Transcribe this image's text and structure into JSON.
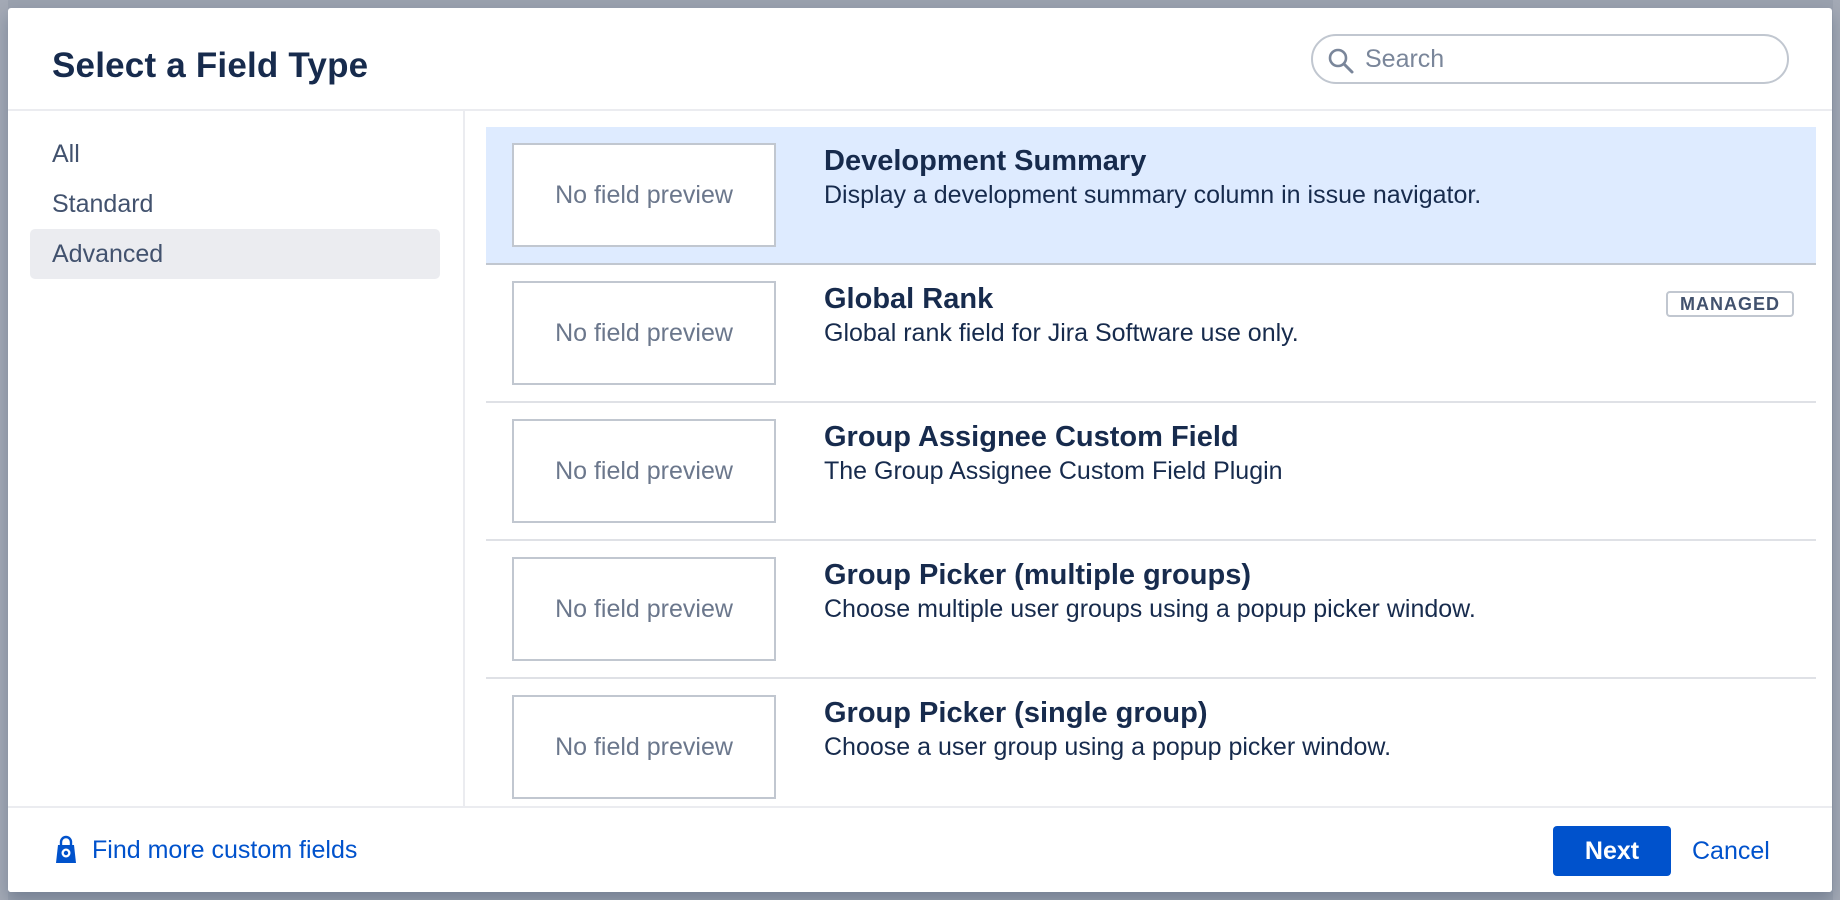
{
  "dialog": {
    "title": "Select a Field Type",
    "search_placeholder": "Search",
    "search_value": ""
  },
  "sidebar": {
    "items": [
      {
        "label": "All",
        "active": false
      },
      {
        "label": "Standard",
        "active": false
      },
      {
        "label": "Advanced",
        "active": true
      }
    ]
  },
  "fields": [
    {
      "title": "Development Summary",
      "description": "Display a development summary column in issue navigator.",
      "preview": "No field preview",
      "badge": "",
      "selected": true
    },
    {
      "title": "Global Rank",
      "description": "Global rank field for Jira Software use only.",
      "preview": "No field preview",
      "badge": "MANAGED",
      "selected": false
    },
    {
      "title": "Group Assignee Custom Field",
      "description": "The Group Assignee Custom Field Plugin",
      "preview": "No field preview",
      "badge": "",
      "selected": false
    },
    {
      "title": "Group Picker (multiple groups)",
      "description": "Choose multiple user groups using a popup picker window.",
      "preview": "No field preview",
      "badge": "",
      "selected": false
    },
    {
      "title": "Group Picker (single group)",
      "description": "Choose a user group using a popup picker window.",
      "preview": "No field preview",
      "badge": "",
      "selected": false
    }
  ],
  "footer": {
    "find_more_label": "Find more custom fields",
    "next_label": "Next",
    "cancel_label": "Cancel"
  },
  "colors": {
    "primary": "#0052cc",
    "selected_row": "#deebff",
    "text": "#172b4d"
  }
}
